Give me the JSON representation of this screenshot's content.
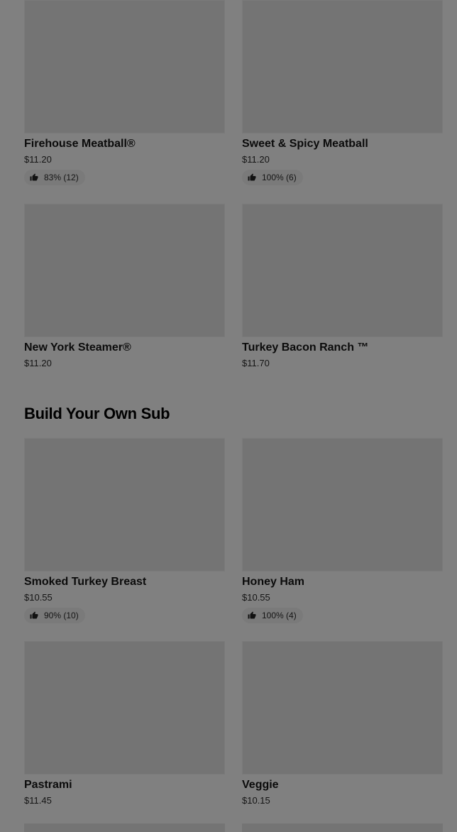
{
  "section_heading": "Build Your Own Sub",
  "icons": {
    "rating": "thumbs-up-icon"
  },
  "items": [
    {
      "name": "Firehouse Meatball®",
      "price": "$11.20",
      "rating": "83% (12)"
    },
    {
      "name": "Sweet & Spicy Meatball",
      "price": "$11.20",
      "rating": "100% (6)"
    },
    {
      "name": "New York Steamer®",
      "price": "$11.20"
    },
    {
      "name": "Turkey Bacon Ranch ™",
      "price": "$11.70"
    },
    {
      "name": "Smoked Turkey Breast",
      "price": "$10.55",
      "rating": "90% (10)"
    },
    {
      "name": "Honey Ham",
      "price": "$10.55",
      "rating": "100% (4)"
    },
    {
      "name": "Pastrami",
      "price": "$11.45"
    },
    {
      "name": "Veggie",
      "price": "$10.15"
    }
  ]
}
